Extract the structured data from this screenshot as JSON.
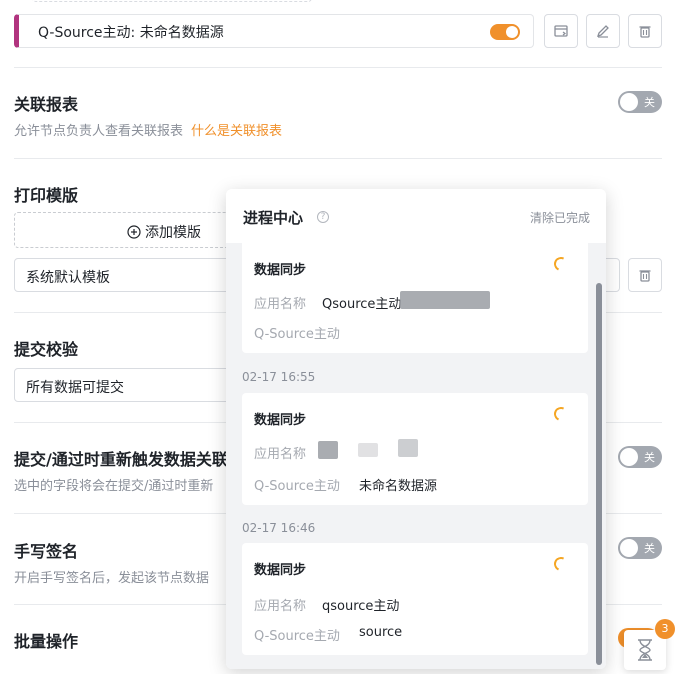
{
  "source": {
    "label": "Q-Source主动: 未命名数据源"
  },
  "sections": {
    "related_report": {
      "title": "关联报表",
      "desc": "允许节点负责人查看关联报表",
      "link": "什么是关联报表",
      "toggle": "关"
    },
    "print_template": {
      "title": "打印模版",
      "add_label": "添加模版",
      "selected": "系统默认模板"
    },
    "submit_check": {
      "title": "提交校验",
      "selected": "所有数据可提交"
    },
    "retrigger": {
      "title": "提交/通过时重新触发数据关联",
      "desc": "选中的字段将会在提交/通过时重新",
      "toggle": "关"
    },
    "signature": {
      "title": "手写签名",
      "desc": "开启手写签名后，发起该节点数据",
      "toggle": "关"
    },
    "batch": {
      "title": "批量操作"
    }
  },
  "popup": {
    "title": "进程中心",
    "clear": "清除已完成",
    "cards": [
      {
        "title": "数据同步",
        "app_label": "应用名称",
        "app_value": "Qsource主动",
        "source_label": "Q-Source主动",
        "source_value": ""
      },
      {
        "time": "02-17 16:55",
        "title": "数据同步",
        "app_label": "应用名称",
        "app_value": "",
        "source_label": "Q-Source主动",
        "source_value": "未命名数据源"
      },
      {
        "time": "02-17 16:46",
        "title": "数据同步",
        "app_label": "应用名称",
        "app_value": "qsource主动",
        "source_label": "Q-Source主动",
        "source_value": "source"
      }
    ]
  },
  "float": {
    "badge": "3"
  },
  "colors": {
    "accent": "#f0902b",
    "source_bar": "#b1347f"
  }
}
